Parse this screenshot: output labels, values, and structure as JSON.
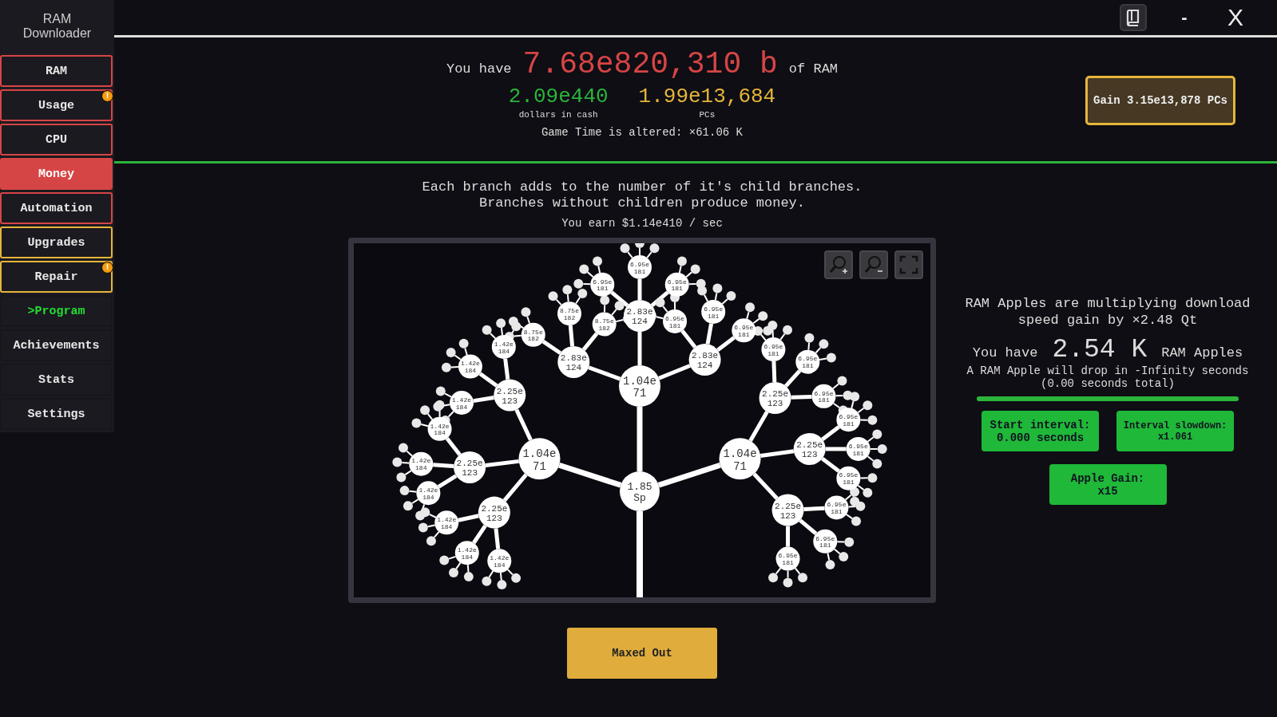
{
  "app_title": "RAM Downloader",
  "sidebar": {
    "items": [
      {
        "label": "RAM",
        "kind": "ram",
        "selected": false
      },
      {
        "label": "Usage",
        "kind": "ram",
        "selected": false,
        "badge": "!"
      },
      {
        "label": "CPU",
        "kind": "ram",
        "selected": false
      },
      {
        "label": "Money",
        "kind": "ram",
        "selected": true
      },
      {
        "label": "Automation",
        "kind": "ram",
        "selected": false
      },
      {
        "label": "Upgrades",
        "kind": "pcs",
        "selected": false
      },
      {
        "label": "Repair",
        "kind": "pcs",
        "selected": false,
        "badge": "!"
      },
      {
        "label": ">Program",
        "kind": "program",
        "selected": false
      },
      {
        "label": "Achievements",
        "kind": "plain",
        "selected": false
      },
      {
        "label": "Stats",
        "kind": "plain",
        "selected": false
      },
      {
        "label": "Settings",
        "kind": "plain",
        "selected": false
      }
    ]
  },
  "window_controls": {
    "minimize": "-",
    "close": "X"
  },
  "header": {
    "prefix": "You have",
    "ram": "7.68e820,310 b",
    "suffix": "of RAM",
    "cash": "2.09e440",
    "cash_label": "dollars in cash",
    "pcs": "1.99e13,684",
    "pcs_label": "PCs",
    "game_time": "Game Time is altered: ×61.06 K",
    "gain_button": "Gain 3.15e13,878 PCs"
  },
  "money": {
    "description": [
      "Each branch adds to the number of it's child branches.",
      "Branches without children produce money."
    ],
    "earn": "You earn $1.14e410 / sec",
    "action_button": "Maxed Out",
    "tree": {
      "mantissa": "1.85",
      "exponent": "Sp",
      "children": [
        {
          "mantissa": "1.04e",
          "exponent": "71",
          "children": [
            {
              "mantissa": "2.25e",
              "exponent": "123",
              "children": [
                {
                  "mantissa": "1.42e",
                  "exponent": "184"
                },
                {
                  "mantissa": "1.42e",
                  "exponent": "184"
                },
                {
                  "mantissa": "1.42e",
                  "exponent": "184"
                }
              ]
            },
            {
              "mantissa": "2.25e",
              "exponent": "123",
              "children": [
                {
                  "mantissa": "1.42e",
                  "exponent": "184"
                },
                {
                  "mantissa": "1.42e",
                  "exponent": "184"
                },
                {
                  "mantissa": "1.42e",
                  "exponent": "184"
                }
              ]
            },
            {
              "mantissa": "2.25e",
              "exponent": "123",
              "children": [
                {
                  "mantissa": "1.42e",
                  "exponent": "184"
                },
                {
                  "mantissa": "1.42e",
                  "exponent": "184"
                },
                {
                  "mantissa": "1.42e",
                  "exponent": "184"
                }
              ]
            }
          ]
        },
        {
          "mantissa": "1.04e",
          "exponent": "71",
          "children": [
            {
              "mantissa": "2.83e",
              "exponent": "124",
              "children": [
                {
                  "mantissa": "8.75e",
                  "exponent": "182"
                },
                {
                  "mantissa": "8.75e",
                  "exponent": "182"
                },
                {
                  "mantissa": "8.75e",
                  "exponent": "182"
                }
              ]
            },
            {
              "mantissa": "2.83e",
              "exponent": "124",
              "children": [
                {
                  "mantissa": "6.95e",
                  "exponent": "181"
                },
                {
                  "mantissa": "6.95e",
                  "exponent": "181"
                },
                {
                  "mantissa": "6.95e",
                  "exponent": "181"
                }
              ]
            },
            {
              "mantissa": "2.83e",
              "exponent": "124",
              "children": [
                {
                  "mantissa": "6.95e",
                  "exponent": "181"
                },
                {
                  "mantissa": "6.95e",
                  "exponent": "181"
                },
                {
                  "mantissa": "6.95e",
                  "exponent": "181"
                }
              ]
            }
          ]
        },
        {
          "mantissa": "1.04e",
          "exponent": "71",
          "children": [
            {
              "mantissa": "2.25e",
              "exponent": "123",
              "children": [
                {
                  "mantissa": "6.95e",
                  "exponent": "181"
                },
                {
                  "mantissa": "6.95e",
                  "exponent": "181"
                },
                {
                  "mantissa": "6.95e",
                  "exponent": "181"
                }
              ]
            },
            {
              "mantissa": "2.25e",
              "exponent": "123",
              "children": [
                {
                  "mantissa": "6.95e",
                  "exponent": "181"
                },
                {
                  "mantissa": "6.95e",
                  "exponent": "181"
                },
                {
                  "mantissa": "6.95e",
                  "exponent": "181"
                }
              ]
            },
            {
              "mantissa": "2.25e",
              "exponent": "123",
              "children": [
                {
                  "mantissa": "6.95e",
                  "exponent": "181"
                },
                {
                  "mantissa": "6.95e",
                  "exponent": "181"
                },
                {
                  "mantissa": "6.95e",
                  "exponent": "181"
                }
              ]
            }
          ]
        }
      ]
    }
  },
  "apples": {
    "multiplier_text": "RAM Apples are multiplying download speed gain by ×2.48 Qt",
    "prefix": "You have",
    "count": "2.54 K",
    "suffix": "RAM Apples",
    "drop_text": "A RAM Apple will drop in -Infinity seconds",
    "total_text": "(0.00 seconds total)",
    "level": 1,
    "buttons": [
      {
        "line1": "Start interval:",
        "line2": "0.000 seconds"
      },
      {
        "line1": "Interval slowdown:",
        "line2": "x1.061"
      },
      {
        "line1": "Apple Gain:",
        "line2": "x15"
      }
    ]
  }
}
